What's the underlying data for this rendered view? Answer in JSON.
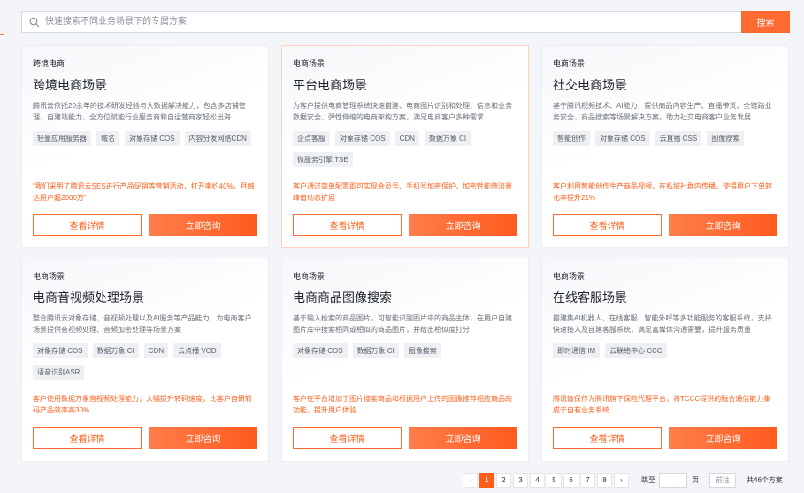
{
  "search": {
    "placeholder": "快速搜索不同业务场景下的专属方案",
    "button_label": "搜索"
  },
  "cards": [
    {
      "category": "跨境电商",
      "title": "跨境电商场景",
      "desc": "腾讯云依托20余年的技术研发经验与大数据解决能力，包含多店铺管理、自建站能力、全方位赋能行业服务商和自运营商家轻松出海",
      "tags": [
        "轻量应用服务器",
        "域名",
        "对象存储 COS",
        "内容分发网络CDN"
      ],
      "case": "“我们采用了腾讯云SES进行产品促销等营销活动，打开率约40%，月触达用户超2000万”",
      "detail_label": "查看详情",
      "consult_label": "立即咨询"
    },
    {
      "category": "电商场景",
      "title": "平台电商场景",
      "desc": "为客户提供电商管理系统快速搭建、电商图片识别和处理、信息和业务数据安全、弹性伸缩的电商架构方案，满足电商客户多种需求",
      "tags": [
        "企点客服",
        "对象存储 COS",
        "CDN",
        "数据万象 CI",
        "微服务引擎 TSE"
      ],
      "case": "客户通过简单配置即可实现会员号、手机号加密保护，加密性能随流量峰值动态扩展",
      "detail_label": "查看详情",
      "consult_label": "立即咨询"
    },
    {
      "category": "电商场景",
      "title": "社交电商场景",
      "desc": "基于腾讯视频技术、AI能力，提供商品内容生产、直播带货、全链路业务安全、商品搜索等场景解决方案，助力社交电商客户业务发展",
      "tags": [
        "智能创作",
        "对象存储 COS",
        "云直播 CSS",
        "图像搜索"
      ],
      "case": "客户利用智能创作生产商品视频，在私域社群内传播，使得用户下单转化率提升21%",
      "detail_label": "查看详情",
      "consult_label": "立即咨询"
    },
    {
      "category": "电商场景",
      "title": "电商音视频处理场景",
      "desc": "整合腾讯云对象存储、音视频处理以及AI服务等产品能力，为电商客户场景提供音视频处理、音频加密处理等场景方案",
      "tags": [
        "对象存储 COS",
        "数据万象 CI",
        "CDN",
        "云点播 VOD",
        "语音识别ASR"
      ],
      "case": "客户使用数据万象音视频处理能力，大幅提升转码速度，比客户自研转码产品效率高30%",
      "detail_label": "查看详情",
      "consult_label": "立即咨询"
    },
    {
      "category": "电商场景",
      "title": "电商商品图像搜索",
      "desc": "基于输入检索的商品图片，可智能识别图片中的商品主体，在用户自建图片库中搜索相同或相似的商品图片，并给出相似度打分",
      "tags": [
        "对象存储 COS",
        "数据万象 CI",
        "图像搜索"
      ],
      "case": "客户在平台增加了图片搜索商品和根据用户上传的图像推荐相应商品的功能，提升用户体验",
      "detail_label": "查看详情",
      "consult_label": "立即咨询"
    },
    {
      "category": "电商场景",
      "title": "在线客服场景",
      "desc": "搭建集AI机器人、在线客服、智能外呼等多功能服务的客服系统，支持快速接入及自建客服系统，满足富媒体沟通需要，提升服务质量",
      "tags": [
        "即时通信 IM",
        "云联络中心 CCC"
      ],
      "case": "腾讯微保作为腾讯旗下保险代理平台，将TCCC提供的融合通信能力集成于自有业务系统",
      "detail_label": "查看详情",
      "consult_label": "立即咨询"
    }
  ],
  "pagination": {
    "prev": "‹",
    "pages": [
      "1",
      "2",
      "3",
      "4",
      "5",
      "6",
      "7",
      "8"
    ],
    "current": "1",
    "next": "›",
    "jump_label": "跳至",
    "page_unit": "页",
    "go_label": "前往",
    "total": "共46个方案"
  },
  "colors": {
    "accent": "#ff5e1a",
    "button_gradient_start": "#ff7e4a",
    "tag_bg": "#eef0f4"
  }
}
